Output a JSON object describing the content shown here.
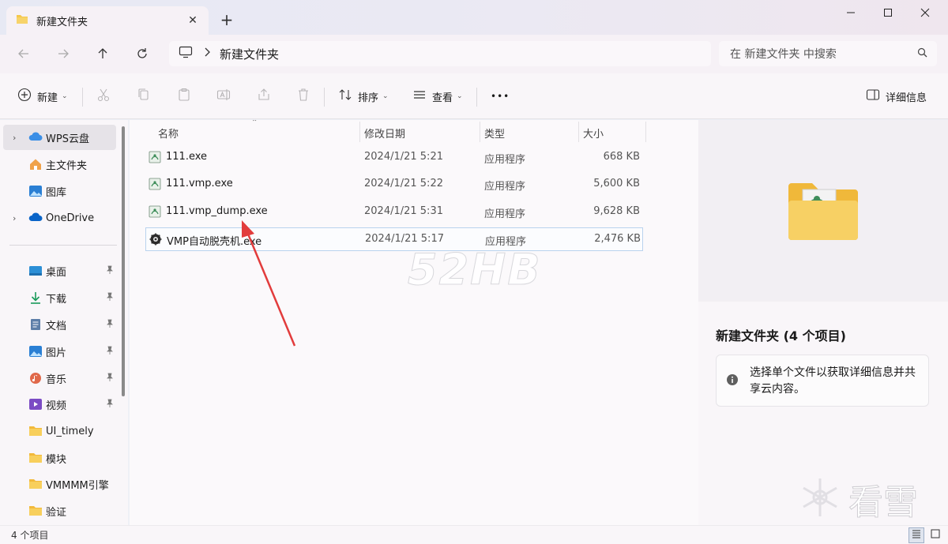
{
  "window": {
    "tab_title": "新建文件夹",
    "tab_close": "✕",
    "new_tab": "+",
    "minimize": "minimize",
    "maximize": "maximize",
    "close": "close"
  },
  "nav": {
    "path_segment": "新建文件夹",
    "search_placeholder": "在 新建文件夹 中搜索"
  },
  "toolbar": {
    "new_label": "新建",
    "sort_label": "排序",
    "view_label": "查看",
    "more_label": "•••",
    "details_label": "详细信息"
  },
  "sidebar": {
    "items": [
      {
        "label": "WPS云盘",
        "icon": "cloud-icon"
      },
      {
        "label": "主文件夹",
        "icon": "home-icon"
      },
      {
        "label": "图库",
        "icon": "gallery-icon"
      },
      {
        "label": "OneDrive",
        "icon": "onedrive-icon"
      },
      {
        "label": "桌面",
        "icon": "desktop-icon"
      },
      {
        "label": "下载",
        "icon": "download-icon"
      },
      {
        "label": "文档",
        "icon": "document-icon"
      },
      {
        "label": "图片",
        "icon": "pictures-icon"
      },
      {
        "label": "音乐",
        "icon": "music-icon"
      },
      {
        "label": "视频",
        "icon": "video-icon"
      },
      {
        "label": "UI_timely",
        "icon": "folder-icon"
      },
      {
        "label": "模块",
        "icon": "folder-icon"
      },
      {
        "label": "VMMMM引擎",
        "icon": "folder-icon"
      },
      {
        "label": "验证",
        "icon": "folder-icon"
      }
    ]
  },
  "files": {
    "columns": {
      "name": "名称",
      "date": "修改日期",
      "type": "类型",
      "size": "大小"
    },
    "rows": [
      {
        "name": "111.exe",
        "date": "2024/1/21 5:21",
        "type": "应用程序",
        "size": "668 KB"
      },
      {
        "name": "111.vmp.exe",
        "date": "2024/1/21 5:22",
        "type": "应用程序",
        "size": "5,600 KB"
      },
      {
        "name": "111.vmp_dump.exe",
        "date": "2024/1/21 5:31",
        "type": "应用程序",
        "size": "9,628 KB"
      },
      {
        "name": "VMP自动脱壳机.exe",
        "date": "2024/1/21 5:17",
        "type": "应用程序",
        "size": "2,476 KB"
      }
    ]
  },
  "watermark": "52HB",
  "details": {
    "title": "新建文件夹 (4 个项目)",
    "message": "选择单个文件以获取详细信息并共享云内容。",
    "brand": "看雪"
  },
  "status": {
    "count": "4 个项目"
  },
  "colors": {
    "accent": "#0067c0",
    "folder": "#f5c84c",
    "arrow": "#e23c3c"
  }
}
